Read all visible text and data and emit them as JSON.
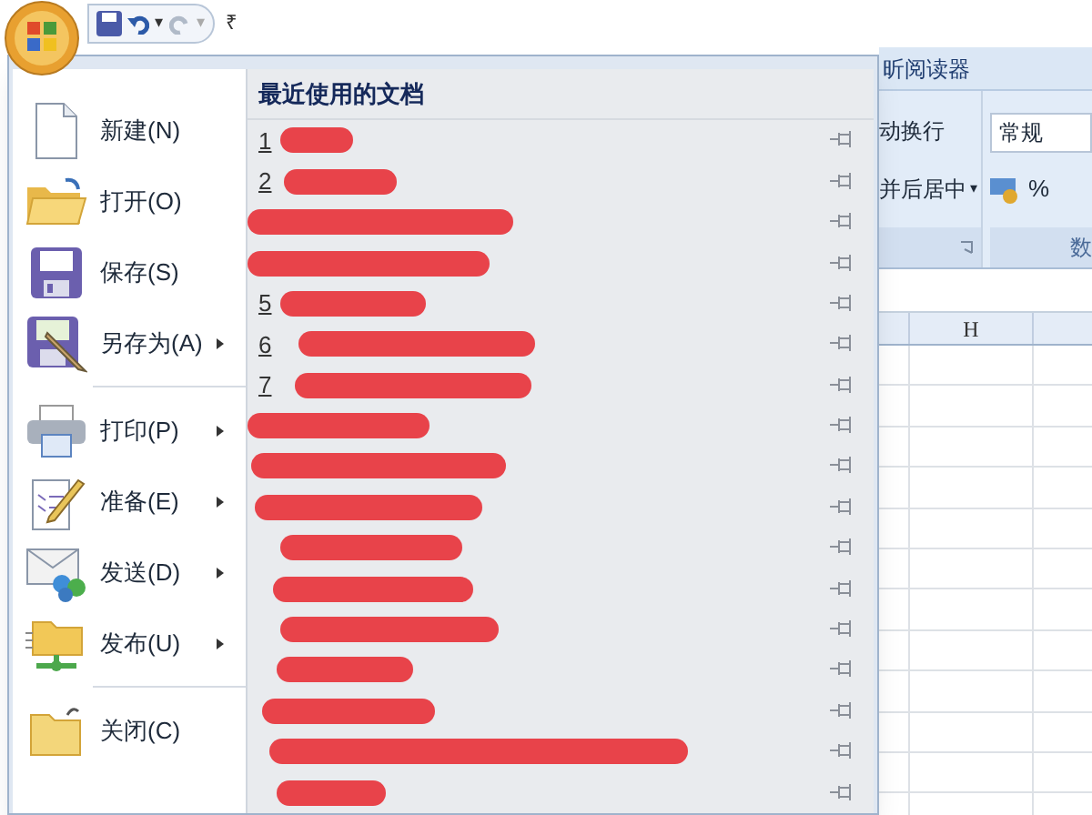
{
  "quick_access": {
    "undo_arrow": "▾",
    "redo_arrow": "▾",
    "customize": "₹"
  },
  "menu": {
    "items": [
      {
        "label": "新建(N)",
        "kind": "new",
        "submenu": false
      },
      {
        "label": "打开(O)",
        "kind": "open",
        "submenu": false
      },
      {
        "label": "保存(S)",
        "kind": "save",
        "submenu": false
      },
      {
        "label": "另存为(A)",
        "kind": "saveas",
        "submenu": true
      },
      {
        "label": "打印(P)",
        "kind": "print",
        "submenu": true
      },
      {
        "label": "准备(E)",
        "kind": "prepare",
        "submenu": true
      },
      {
        "label": "发送(D)",
        "kind": "send",
        "submenu": true
      },
      {
        "label": "发布(U)",
        "kind": "publish",
        "submenu": true
      },
      {
        "label": "关闭(C)",
        "kind": "close",
        "submenu": false
      }
    ],
    "recent_title": "最近使用的文档",
    "recent": [
      {
        "kind": "numbered",
        "number": "1"
      },
      {
        "kind": "numbered",
        "number": "2"
      },
      {
        "kind": "hidden"
      },
      {
        "kind": "hidden"
      },
      {
        "kind": "numbered",
        "number": "5"
      },
      {
        "kind": "numbered",
        "number": "6"
      },
      {
        "kind": "numbered",
        "number": "7"
      },
      {
        "kind": "hidden"
      },
      {
        "kind": "hidden"
      },
      {
        "kind": "hidden"
      },
      {
        "kind": "hidden"
      },
      {
        "kind": "hidden"
      },
      {
        "kind": "hidden"
      },
      {
        "kind": "hidden"
      },
      {
        "kind": "hidden"
      },
      {
        "kind": "hidden"
      },
      {
        "kind": "hidden"
      }
    ]
  },
  "ribbon": {
    "tab": "昕阅读器",
    "wrap": "动换行",
    "merge": "并后居中",
    "merge_arrow": "▾",
    "format": "常规",
    "percent": "%",
    "group_label": "数"
  },
  "sheet": {
    "column": "H"
  }
}
